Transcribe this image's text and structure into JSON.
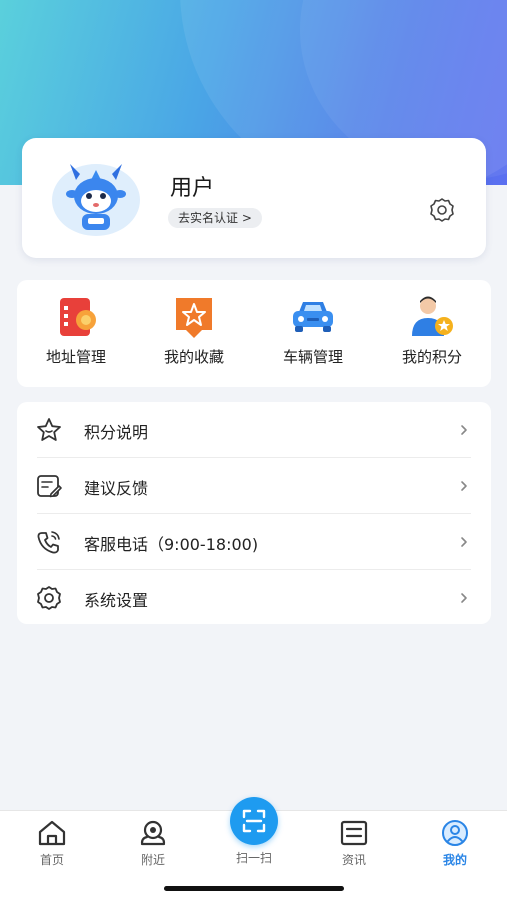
{
  "profile": {
    "username": "用户",
    "verify_label": "去实名认证 >"
  },
  "quick_actions": [
    {
      "label": "地址管理",
      "icon": "address-book-icon"
    },
    {
      "label": "我的收藏",
      "icon": "favorite-star-icon"
    },
    {
      "label": "车辆管理",
      "icon": "car-icon"
    },
    {
      "label": "我的积分",
      "icon": "user-points-icon"
    }
  ],
  "menu": [
    {
      "label": "积分说明",
      "icon": "star-outline-icon"
    },
    {
      "label": "建议反馈",
      "icon": "feedback-edit-icon"
    },
    {
      "label": "客服电话（9:00-18:00)",
      "icon": "phone-icon"
    },
    {
      "label": "系统设置",
      "icon": "gear-icon"
    }
  ],
  "tabbar": {
    "items": [
      {
        "label": "首页",
        "icon": "home-icon"
      },
      {
        "label": "附近",
        "icon": "location-icon"
      },
      {
        "label": "扫一扫",
        "icon": "scan-icon"
      },
      {
        "label": "资讯",
        "icon": "news-icon"
      },
      {
        "label": "我的",
        "icon": "profile-icon",
        "active": true
      }
    ]
  },
  "colors": {
    "accent": "#2a85e6",
    "scan_button": "#1e9bf0",
    "background": "#f2f4f8"
  }
}
